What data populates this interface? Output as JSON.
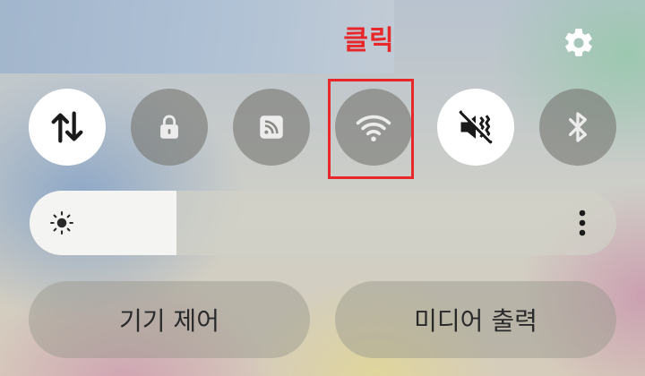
{
  "annotation": {
    "label": "클릭",
    "color": "#e8272a"
  },
  "quick_tiles": [
    {
      "name": "mobile-data",
      "icon": "data-arrows-icon",
      "state": "on"
    },
    {
      "name": "lock",
      "icon": "lock-icon",
      "state": "off"
    },
    {
      "name": "nfc",
      "icon": "nfc-icon",
      "state": "off"
    },
    {
      "name": "wifi",
      "icon": "wifi-icon",
      "state": "off"
    },
    {
      "name": "sound",
      "icon": "vibrate-mute-icon",
      "state": "on"
    },
    {
      "name": "bluetooth",
      "icon": "bluetooth-icon",
      "state": "off"
    }
  ],
  "brightness": {
    "level": 0.25,
    "icon": "sun-icon",
    "more_icon": "more-vertical-icon"
  },
  "buttons": {
    "device_control": "기기 제어",
    "media_output": "미디어 출력"
  },
  "settings_icon": "gear-icon"
}
